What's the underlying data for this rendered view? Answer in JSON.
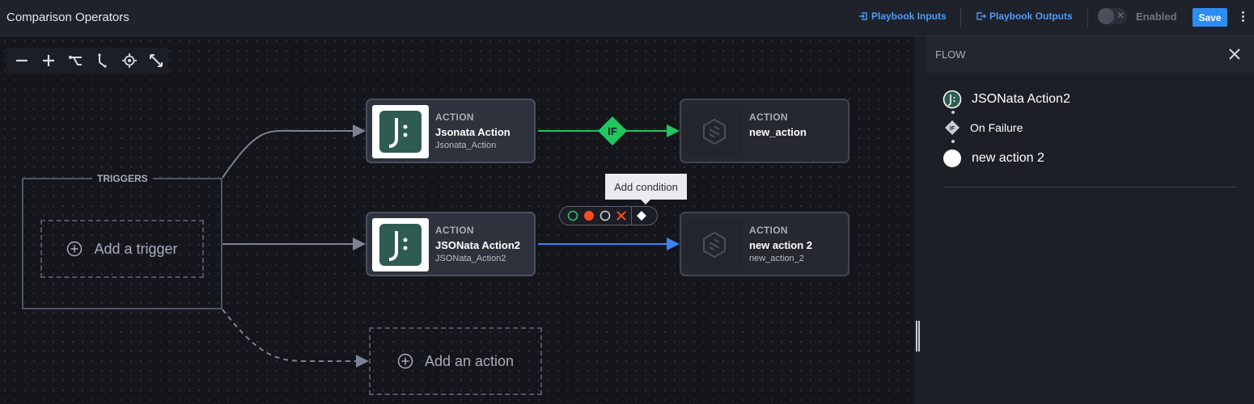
{
  "header": {
    "title": "Comparison Operators",
    "inputs_label": "Playbook Inputs",
    "outputs_label": "Playbook Outputs",
    "toggle_icon": "x-icon",
    "enabled_label": "Enabled",
    "save_label": "Save",
    "accent_color": "#2e8cf5"
  },
  "toolbar": {
    "tools": [
      "zoom-out-icon",
      "zoom-in-icon",
      "auto-layout-icon",
      "connector-icon",
      "center-icon",
      "fit-view-icon"
    ]
  },
  "canvas": {
    "triggers_label": "TRIGGERS",
    "add_trigger": "Add a trigger",
    "add_action": "Add an action",
    "condition_badge": "IF",
    "tooltip": "Add condition",
    "edge_colors": {
      "success": "#22c55e",
      "selected": "#3b82f6",
      "default": "#7b8294"
    },
    "nodes": [
      {
        "type": "ACTION",
        "name": "Jsonata Action",
        "sub": "Jsonata_Action"
      },
      {
        "type": "ACTION",
        "name": "new_action",
        "sub": ""
      },
      {
        "type": "ACTION",
        "name": "JSONata Action2",
        "sub": "JSONata_Action2"
      },
      {
        "type": "ACTION",
        "name": "new action 2",
        "sub": "new_action_2"
      }
    ],
    "condition_options": [
      "success-circle-icon",
      "failure-dot-icon",
      "always-circle-icon",
      "skip-x-icon",
      "condition-diamond-icon"
    ]
  },
  "panel": {
    "title": "FLOW",
    "items": [
      {
        "label": "JSONata Action2",
        "icon": "jsonata-icon"
      },
      {
        "label": "On Failure",
        "icon": "if-diamond-icon"
      },
      {
        "label": "new action 2",
        "icon": "white-circle-icon"
      }
    ]
  }
}
